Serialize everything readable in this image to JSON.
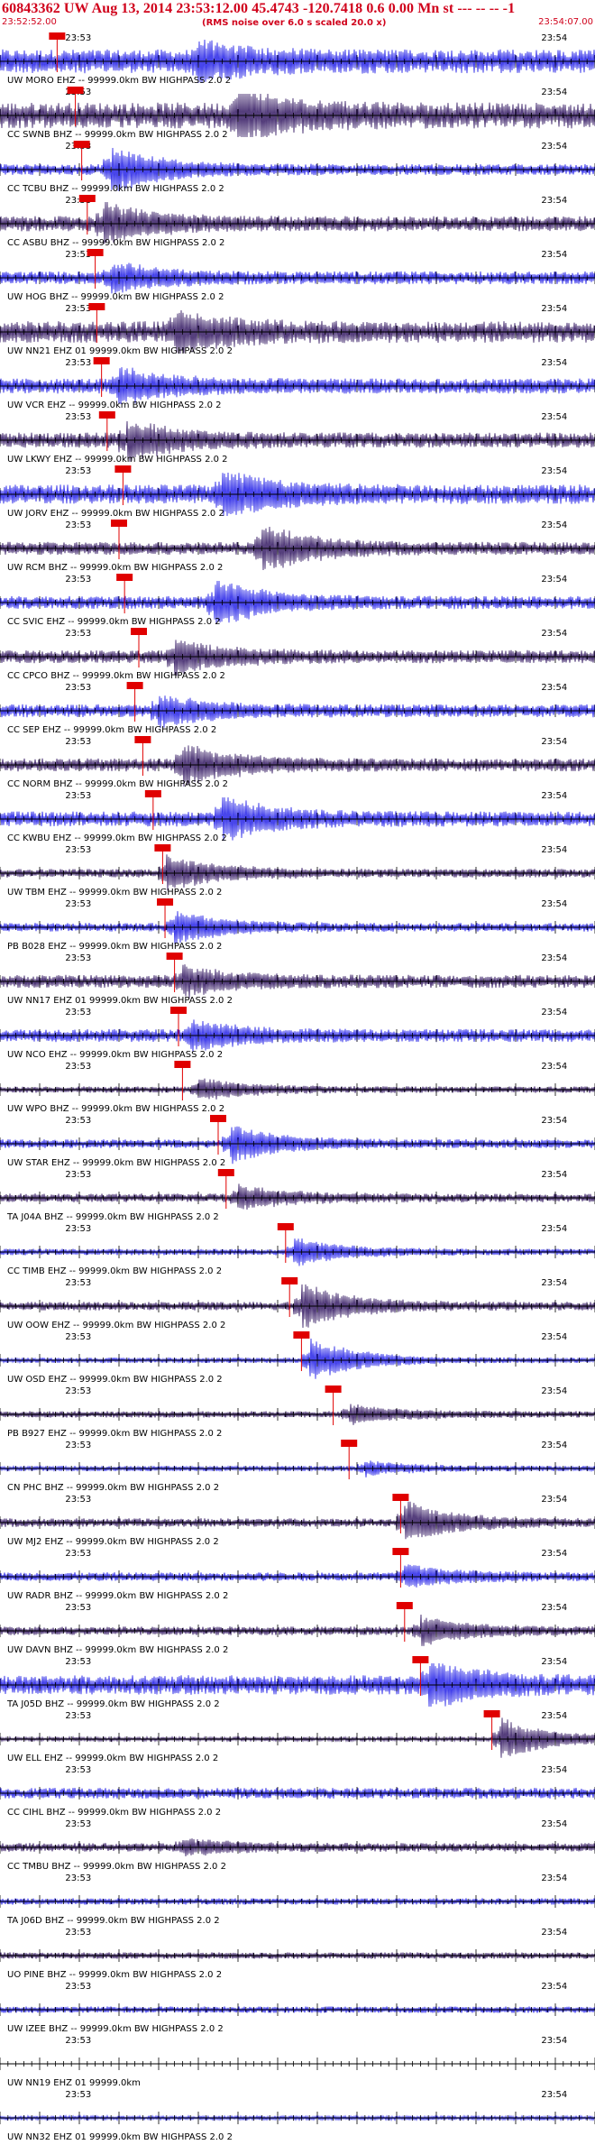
{
  "header": {
    "title": "60843362 UW Aug 13, 2014 23:53:12.00   45.4743 -120.7418  0.6 0.00 Mn st --- -- --  -1",
    "start_time": "23:52:52.00",
    "rms_note": "(RMS noise over 6.0 s scaled 20.0 x)",
    "end_time": "23:54:07.00"
  },
  "colors": {
    "header_text": "#d0021b",
    "trace_a": "#1a17e6",
    "trace_b": "#2b0f5c",
    "pick": "#e00000",
    "tick": "#000000"
  },
  "chart_data": {
    "type": "line",
    "title": "60843362 UW Aug 13, 2014 23:53:12.00   45.4743 -120.7418  0.6 0.00 Mn st --- -- --  -1",
    "xlabel": "",
    "ylabel": "",
    "x_range": [
      "23:52:52.00",
      "23:54:07.00"
    ],
    "x_range_seconds": [
      0,
      75
    ],
    "major_tick_interval_s": 5,
    "minor_tick_interval_s": 1,
    "time_labels": [
      "23:53",
      "23:54"
    ],
    "time_label_seconds": [
      8,
      68
    ],
    "grid": false,
    "series": [
      {
        "name": "UW MORO EHZ -- 99999.0km BW  HIGHPASS  2.0  2",
        "pick_s": 7.2,
        "amp": 0.55,
        "event_s": 25,
        "event_amp": 0.7
      },
      {
        "name": "CC SWNB BHZ -- 99999.0km BW  HIGHPASS  2.0  2",
        "pick_s": 9.5,
        "amp": 0.6,
        "event_s": 30,
        "event_amp": 1.0
      },
      {
        "name": "CC TCBU BHZ -- 99999.0km BW  HIGHPASS  2.0  2",
        "pick_s": 10.3,
        "amp": 0.25,
        "event_s": 14,
        "event_amp": 1.0
      },
      {
        "name": "CC ASBU BHZ -- 99999.0km BW  HIGHPASS  2.0  2",
        "pick_s": 11.0,
        "amp": 0.35,
        "event_s": 13,
        "event_amp": 0.8
      },
      {
        "name": "UW HOG BHZ -- 99999.0km BW  HIGHPASS  2.0  2",
        "pick_s": 12.0,
        "amp": 0.3,
        "event_s": 14,
        "event_amp": 0.6
      },
      {
        "name": "UW NN21 EHZ 01 99999.0km BW  HIGHPASS  2.0  2",
        "pick_s": 12.2,
        "amp": 0.5,
        "event_s": 22,
        "event_amp": 0.8
      },
      {
        "name": "UW VCR EHZ -- 99999.0km BW  HIGHPASS  2.0  2",
        "pick_s": 12.8,
        "amp": 0.35,
        "event_s": 15,
        "event_amp": 0.7
      },
      {
        "name": "UW LKWY EHZ -- 99999.0km BW  HIGHPASS  2.0  2",
        "pick_s": 13.5,
        "amp": 0.35,
        "event_s": 16,
        "event_amp": 0.8
      },
      {
        "name": "UW JORV EHZ -- 99999.0km BW  HIGHPASS  2.0  2",
        "pick_s": 15.5,
        "amp": 0.45,
        "event_s": 28,
        "event_amp": 1.0
      },
      {
        "name": "UW RCM BHZ -- 99999.0km BW  HIGHPASS  2.0  2",
        "pick_s": 15.0,
        "amp": 0.3,
        "event_s": 33,
        "event_amp": 1.0
      },
      {
        "name": "CC SVIC EHZ -- 99999.0km BW  HIGHPASS  2.0  2",
        "pick_s": 15.7,
        "amp": 0.3,
        "event_s": 27,
        "event_amp": 1.0
      },
      {
        "name": "CC CPCO BHZ -- 99999.0km BW  HIGHPASS  2.0  2",
        "pick_s": 17.5,
        "amp": 0.3,
        "event_s": 22,
        "event_amp": 0.7
      },
      {
        "name": "CC SEP EHZ -- 99999.0km BW  HIGHPASS  2.0  2",
        "pick_s": 17.0,
        "amp": 0.3,
        "event_s": 20,
        "event_amp": 0.6
      },
      {
        "name": "CC NORM BHZ -- 99999.0km BW  HIGHPASS  2.0  2",
        "pick_s": 18.0,
        "amp": 0.3,
        "event_s": 23,
        "event_amp": 0.9
      },
      {
        "name": "CC KWBU EHZ -- 99999.0km BW  HIGHPASS  2.0  2",
        "pick_s": 19.3,
        "amp": 0.35,
        "event_s": 28,
        "event_amp": 0.9
      },
      {
        "name": "UW TBM EHZ -- 99999.0km BW  HIGHPASS  2.0  2",
        "pick_s": 20.5,
        "amp": 0.2,
        "event_s": 21,
        "event_amp": 0.8
      },
      {
        "name": "PB B028 EHZ -- 99999.0km BW  HIGHPASS  2.0  2",
        "pick_s": 20.8,
        "amp": 0.2,
        "event_s": 22,
        "event_amp": 0.7
      },
      {
        "name": "UW NN17 EHZ 01 99999.0km BW  HIGHPASS  2.0  2",
        "pick_s": 22.0,
        "amp": 0.3,
        "event_s": 23,
        "event_amp": 0.6
      },
      {
        "name": "UW NCO EHZ -- 99999.0km BW  HIGHPASS  2.0  2",
        "pick_s": 22.5,
        "amp": 0.3,
        "event_s": 24,
        "event_amp": 0.6
      },
      {
        "name": "UW WPO BHZ -- 99999.0km BW  HIGHPASS  2.0  2",
        "pick_s": 23.0,
        "amp": 0.15,
        "event_s": 25,
        "event_amp": 0.5
      },
      {
        "name": "UW STAR EHZ -- 99999.0km BW  HIGHPASS  2.0  2",
        "pick_s": 27.5,
        "amp": 0.2,
        "event_s": 29,
        "event_amp": 0.8
      },
      {
        "name": "TA J04A BHZ -- 99999.0km BW  HIGHPASS  2.0  2",
        "pick_s": 28.5,
        "amp": 0.2,
        "event_s": 30,
        "event_amp": 0.5
      },
      {
        "name": "CC TIMB EHZ -- 99999.0km BW  HIGHPASS  2.0  2",
        "pick_s": 36.0,
        "amp": 0.15,
        "event_s": 37,
        "event_amp": 0.6
      },
      {
        "name": "UW OOW EHZ -- 99999.0km BW  HIGHPASS  2.0  2",
        "pick_s": 36.5,
        "amp": 0.2,
        "event_s": 38,
        "event_amp": 1.0
      },
      {
        "name": "UW OSD EHZ -- 99999.0km BW  HIGHPASS  2.0  2",
        "pick_s": 38.0,
        "amp": 0.12,
        "event_s": 39,
        "event_amp": 1.0
      },
      {
        "name": "PB B927 EHZ -- 99999.0km BW  HIGHPASS  2.0  2",
        "pick_s": 42.0,
        "amp": 0.15,
        "event_s": 44,
        "event_amp": 0.4
      },
      {
        "name": "CN PHC BHZ -- 99999.0km BW  HIGHPASS  2.0  2",
        "pick_s": 44.0,
        "amp": 0.12,
        "event_s": 46,
        "event_amp": 0.3
      },
      {
        "name": "UW MJ2 EHZ -- 99999.0km BW  HIGHPASS  2.0  2",
        "pick_s": 50.5,
        "amp": 0.2,
        "event_s": 51,
        "event_amp": 0.9
      },
      {
        "name": "UW RADR BHZ -- 99999.0km BW  HIGHPASS  2.0  2",
        "pick_s": 50.5,
        "amp": 0.2,
        "event_s": 51,
        "event_amp": 0.5
      },
      {
        "name": "UW DAVN BHZ -- 99999.0km BW  HIGHPASS  2.0  2",
        "pick_s": 51.0,
        "amp": 0.2,
        "event_s": 53,
        "event_amp": 0.6
      },
      {
        "name": "TA J05D BHZ -- 99999.0km BW  HIGHPASS  2.0  2",
        "pick_s": 53.0,
        "amp": 0.45,
        "event_s": 54,
        "event_amp": 1.0
      },
      {
        "name": "UW ELL EHZ -- 99999.0km BW  HIGHPASS  2.0  2",
        "pick_s": 62.0,
        "amp": 0.1,
        "event_s": 63,
        "event_amp": 1.0
      },
      {
        "name": "CC CIHL BHZ -- 99999.0km BW  HIGHPASS  2.0  2",
        "pick_s": null,
        "amp": 0.25,
        "event_s": null,
        "event_amp": 0
      },
      {
        "name": "CC TMBU BHZ -- 99999.0km BW  HIGHPASS  2.0  2",
        "pick_s": null,
        "amp": 0.2,
        "event_s": 23,
        "event_amp": 0.3
      },
      {
        "name": "TA J06D BHZ -- 99999.0km BW  HIGHPASS  2.0  2",
        "pick_s": null,
        "amp": 0.15,
        "event_s": null,
        "event_amp": 0
      },
      {
        "name": "UO PINE BHZ -- 99999.0km BW  HIGHPASS  2.0  2",
        "pick_s": null,
        "amp": 0.15,
        "event_s": null,
        "event_amp": 0
      },
      {
        "name": "UW IZEE BHZ -- 99999.0km BW  HIGHPASS  2.0  2",
        "pick_s": null,
        "amp": 0.15,
        "event_s": null,
        "event_amp": 0
      },
      {
        "name": "UW NN19 EHZ 01 99999.0km",
        "pick_s": null,
        "amp": 0.0,
        "event_s": null,
        "event_amp": 0
      },
      {
        "name": "UW NN32 EHZ 01 99999.0km BW  HIGHPASS  2.0  2",
        "pick_s": null,
        "amp": 0.1,
        "event_s": null,
        "event_amp": 0
      }
    ]
  }
}
